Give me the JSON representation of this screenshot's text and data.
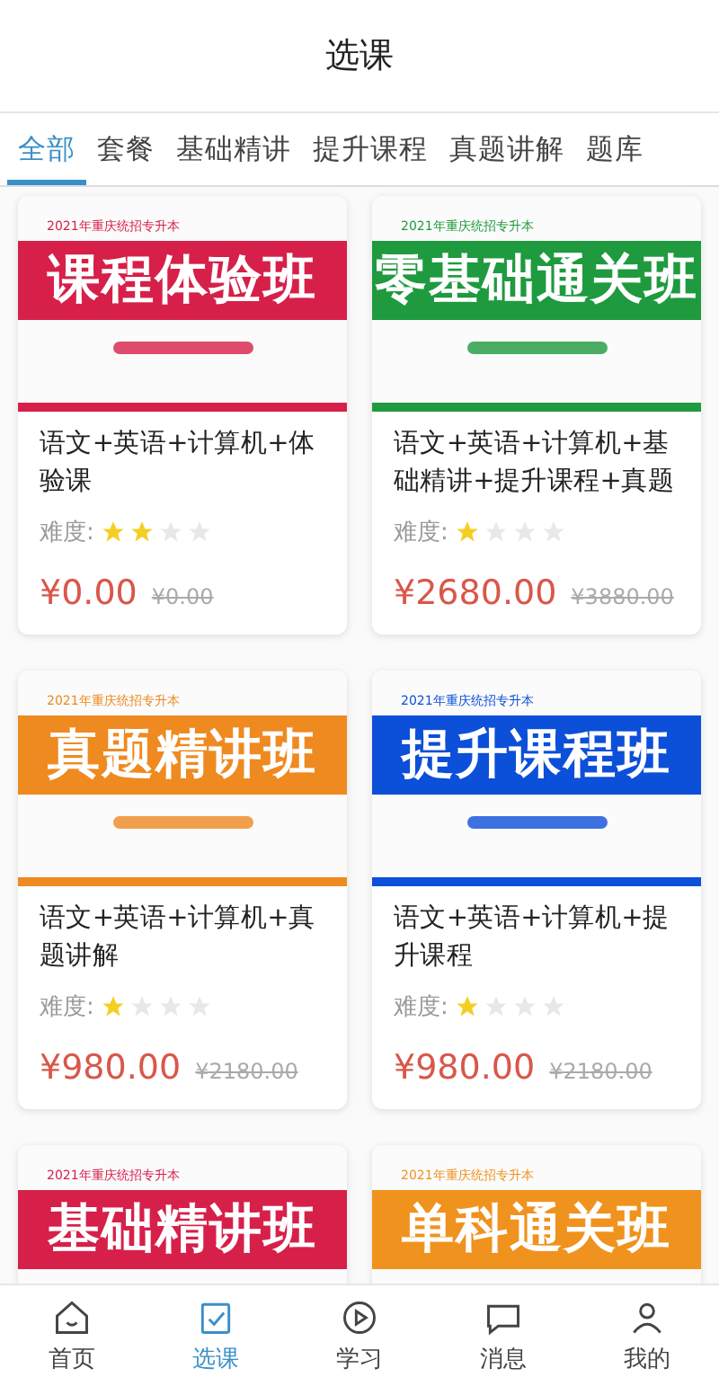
{
  "header": {
    "title": "选课"
  },
  "tabs": [
    {
      "label": "全部",
      "selected": true
    },
    {
      "label": "套餐",
      "selected": false
    },
    {
      "label": "基础精讲",
      "selected": false
    },
    {
      "label": "提升课程",
      "selected": false
    },
    {
      "label": "真题讲解",
      "selected": false
    },
    {
      "label": "题库",
      "selected": false
    }
  ],
  "courses": [
    {
      "banner": {
        "year_label": "2021年重庆统招专升本",
        "title": "课程体验班",
        "color": "#d6204a"
      },
      "title": "语文+英语+计算机+体验课",
      "difficulty_label": "难度:",
      "stars": 2,
      "price": "¥0.00",
      "original_price": "¥0.00"
    },
    {
      "banner": {
        "year_label": "2021年重庆统招专升本",
        "title": "零基础通关班",
        "color": "#1f9a3f"
      },
      "title": "语文+英语+计算机+基础精讲+提升课程+真题",
      "difficulty_label": "难度:",
      "stars": 1,
      "price": "¥2680.00",
      "original_price": "¥3880.00"
    },
    {
      "banner": {
        "year_label": "2021年重庆统招专升本",
        "title": "真题精讲班",
        "color": "#ee8a20"
      },
      "title": "语文+英语+计算机+真题讲解",
      "difficulty_label": "难度:",
      "stars": 1,
      "price": "¥980.00",
      "original_price": "¥2180.00"
    },
    {
      "banner": {
        "year_label": "2021年重庆统招专升本",
        "title": "提升课程班",
        "color": "#0c4fd8"
      },
      "title": "语文+英语+计算机+提升课程",
      "difficulty_label": "难度:",
      "stars": 1,
      "price": "¥980.00",
      "original_price": "¥2180.00"
    },
    {
      "banner": {
        "year_label": "2021年重庆统招专升本",
        "title": "基础精讲班",
        "color": "#d6204a"
      }
    },
    {
      "banner": {
        "year_label": "2021年重庆统招专升本",
        "title": "单科通关班",
        "color": "#f0921e"
      }
    }
  ],
  "bottom_nav": [
    {
      "label": "首页",
      "kind": "home",
      "selected": false
    },
    {
      "label": "选课",
      "kind": "select",
      "selected": true
    },
    {
      "label": "学习",
      "kind": "play",
      "selected": false
    },
    {
      "label": "消息",
      "kind": "message",
      "selected": false
    },
    {
      "label": "我的",
      "kind": "user",
      "selected": false
    }
  ]
}
